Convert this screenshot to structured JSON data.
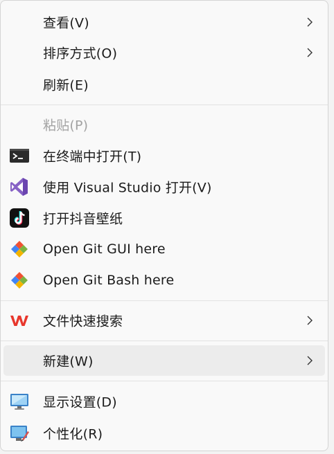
{
  "menu": {
    "items": [
      {
        "label": "查看(V)",
        "has_submenu": true
      },
      {
        "label": "排序方式(O)",
        "has_submenu": true
      },
      {
        "label": "刷新(E)"
      },
      {
        "label": "粘贴(P)",
        "disabled": true
      },
      {
        "label": "在终端中打开(T)",
        "icon": "terminal-icon"
      },
      {
        "label": "使用 Visual Studio 打开(V)",
        "icon": "visual-studio-icon"
      },
      {
        "label": "打开抖音壁纸",
        "icon": "tiktok-icon"
      },
      {
        "label": "Open Git GUI here",
        "icon": "git-gui-icon"
      },
      {
        "label": "Open Git Bash here",
        "icon": "git-bash-icon"
      },
      {
        "label": "文件快速搜索",
        "icon": "wps-icon",
        "has_submenu": true
      },
      {
        "label": "新建(W)",
        "has_submenu": true,
        "highlighted": true
      },
      {
        "label": "显示设置(D)",
        "icon": "display-settings-icon"
      },
      {
        "label": "个性化(R)",
        "icon": "personalize-icon"
      }
    ]
  },
  "colors": {
    "background": "#f9f9f9",
    "hover": "#ececec",
    "text": "#1b1b1b",
    "disabled_text": "#a3a3a3",
    "separator": "#e2e2e2"
  }
}
